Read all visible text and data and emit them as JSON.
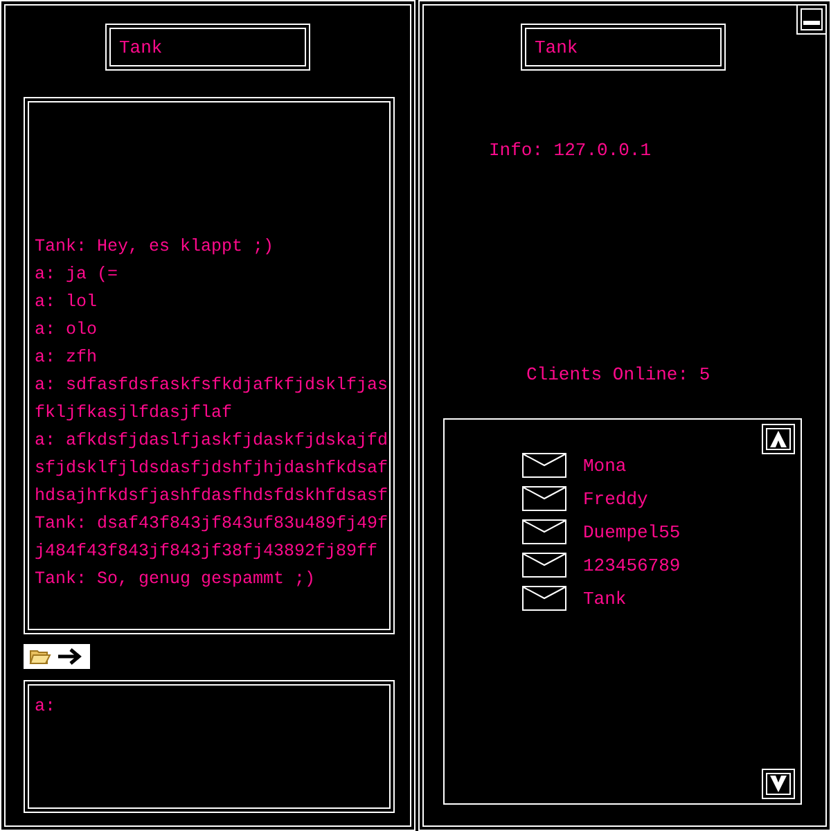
{
  "chat_window": {
    "title": "Tank",
    "messages": [
      "Tank: Hey, es klappt ;)",
      "a: ja (=",
      "a: lol",
      "a: olo",
      "a: zfh",
      "a: sdfasfdsfaskfsfkdjafkfjdsklfjasfkljfkasjlfdasjflaf",
      "a: afkdsfjdaslfjaskfjdaskfjdskajfdsfjdsklfjldsdasfjdshfjhjdashfkdsafhdsajhfkdsfjashfdasfhdsfdskhfdsasf",
      "Tank: dsaf43f843jf843uf83u489fj49fj484f43f843jf843jf38fj43892fj89ff",
      "Tank: So, genug gespammt ;)"
    ],
    "input": {
      "value": "a:"
    }
  },
  "server_window": {
    "title": "Tank",
    "info": "Info: 127.0.0.1",
    "clients_online": "Clients Online: 5",
    "clients": [
      "Mona",
      "Freddy",
      "Duempel55",
      "123456789",
      "Tank"
    ]
  }
}
